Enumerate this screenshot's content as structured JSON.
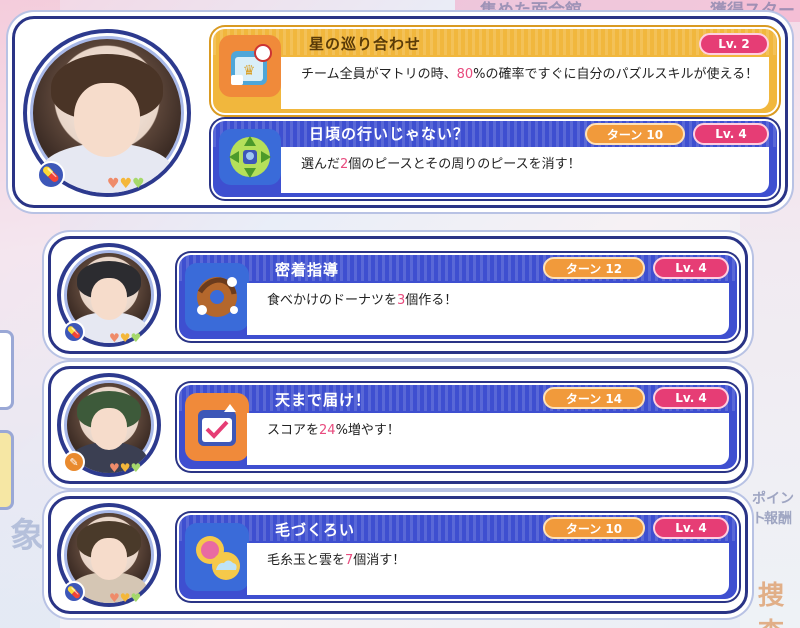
{
  "background": {
    "top_text": "集めた面会館",
    "right_text": "獲得スター",
    "side_text": "象",
    "right_text_2": "ポイント",
    "right_text_3": "報酬",
    "right_text_4": "捜査"
  },
  "leader": {
    "skill": {
      "name": "星の巡り合わせ",
      "level": "Lv. 2",
      "desc_pre": "チーム全員がマトリの時、",
      "desc_hl": "80",
      "desc_post": "%の確率ですぐに自分のパズルスキルが使える！",
      "icon": "crown-calendar-icon"
    },
    "puzzle_skill": {
      "name": "日頃の行いじゃない？",
      "turn": "ターン 10",
      "level": "Lv. 4",
      "desc_pre": "選んだ",
      "desc_hl": "2",
      "desc_post": "個のピースとその周りのピースを消す！",
      "icon": "piece-burst-icon"
    }
  },
  "members": [
    {
      "skill_name": "密着指導",
      "turn": "ターン 12",
      "level": "Lv. 4",
      "desc_pre": "食べかけのドーナツを",
      "desc_hl": "3",
      "desc_post": "個作る！",
      "icon": "donut-icon",
      "type_icon": "pill-icon"
    },
    {
      "skill_name": "天まで届け！",
      "turn": "ターン 14",
      "level": "Lv. 4",
      "desc_pre": "スコアを",
      "desc_hl": "24",
      "desc_post": "%増やす！",
      "icon": "calendar-check-icon",
      "type_icon": "feather-icon"
    },
    {
      "skill_name": "毛づくろい",
      "turn": "ターン 10",
      "level": "Lv. 4",
      "desc_pre": "毛糸玉と雲を",
      "desc_hl": "7",
      "desc_post": "個消す！",
      "icon": "yarn-cloud-icon",
      "type_icon": "pill-icon"
    }
  ],
  "colors": {
    "leader_header": "#f1b73d",
    "puzzle_header": "#3e4fd0",
    "card_border": "#2a3486",
    "level_pill": "#e63d75",
    "turn_pill": "#f19a3b",
    "highlight": "#e84b7e"
  }
}
